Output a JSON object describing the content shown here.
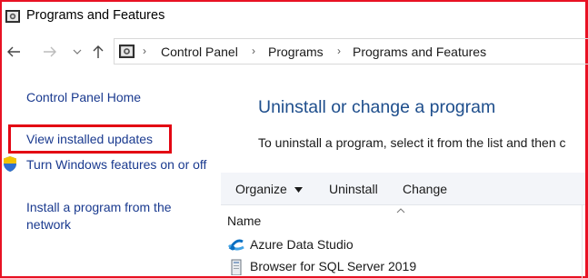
{
  "window": {
    "title": "Programs and Features",
    "icon": "control-panel-icon",
    "accent_color": "#e81123"
  },
  "navigation": {
    "back_icon": "back-arrow-icon",
    "forward_icon": "forward-arrow-icon",
    "recent_icon": "chevron-down-icon",
    "up_icon": "up-arrow-icon",
    "breadcrumbs": [
      "Control Panel",
      "Programs",
      "Programs and Features"
    ],
    "separator": "›"
  },
  "sidebar": {
    "items": [
      {
        "label": "Control Panel Home"
      },
      {
        "label": "View installed updates",
        "highlighted": true,
        "highlight_color": "#e30613"
      },
      {
        "label": "Turn Windows features on or off",
        "icon": "shield-icon"
      },
      {
        "label": "Install a program from the network"
      }
    ]
  },
  "main": {
    "heading": "Uninstall or change a program",
    "description": "To uninstall a program, select it from the list and then c",
    "toolbar": {
      "organize": "Organize",
      "uninstall": "Uninstall",
      "change": "Change"
    },
    "table": {
      "column_header": "Name",
      "rows": [
        {
          "name": "Azure Data Studio",
          "icon": "azure-data-studio-icon"
        },
        {
          "name": "Browser for SQL Server 2019",
          "icon": "installer-icon"
        }
      ]
    }
  }
}
